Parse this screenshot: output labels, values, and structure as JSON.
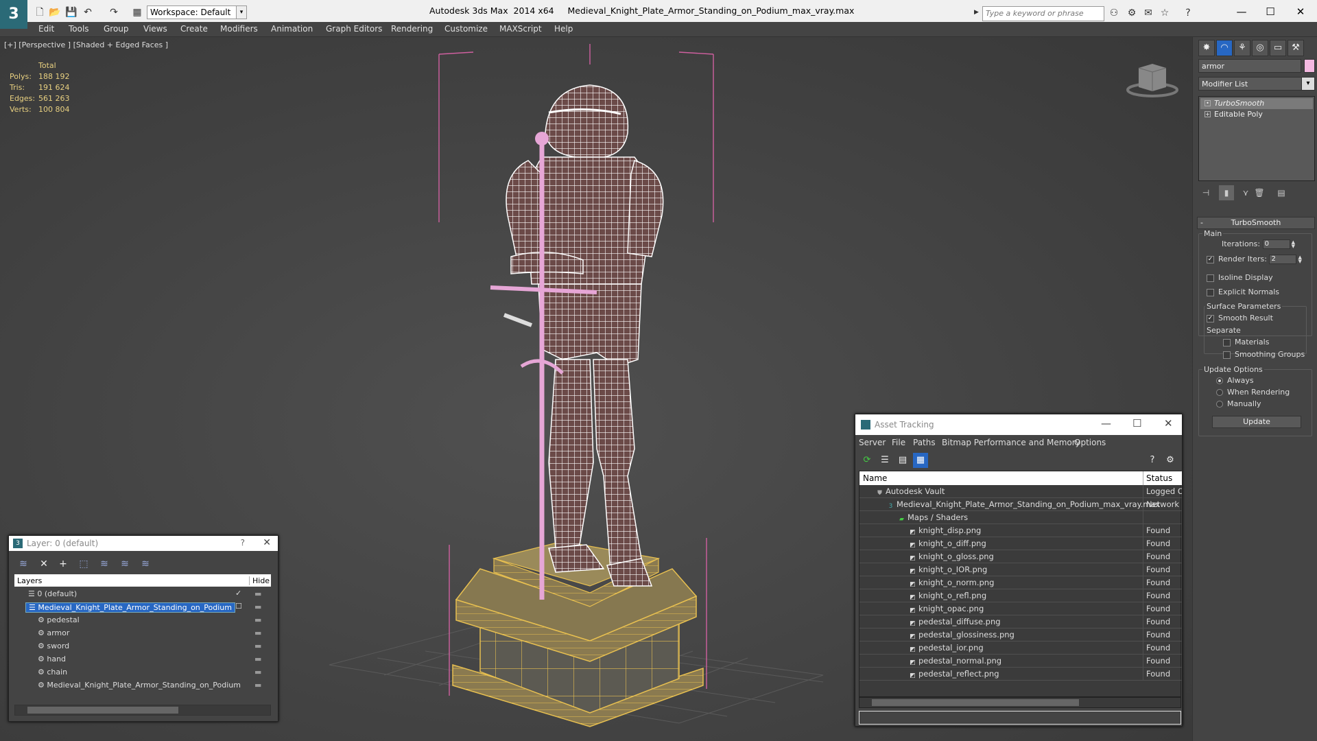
{
  "app": {
    "title": "Autodesk 3ds Max  2014 x64     Medieval_Knight_Plate_Armor_Standing_on_Podium_max_vray.max",
    "workspace": "Workspace: Default",
    "search_placeholder": "Type a keyword or phrase"
  },
  "menu": [
    "Edit",
    "Tools",
    "Group",
    "Views",
    "Create",
    "Modifiers",
    "Animation",
    "Graph Editors",
    "Rendering",
    "Customize",
    "MAXScript",
    "Help"
  ],
  "viewport": {
    "label": "[+] [Perspective ] [Shaded + Edged Faces ]",
    "stats_header": "Total",
    "stats": [
      {
        "k": "Polys:",
        "v": "188 192"
      },
      {
        "k": "Tris:",
        "v": "191 624"
      },
      {
        "k": "Edges:",
        "v": "561 263"
      },
      {
        "k": "Verts:",
        "v": "100 804"
      }
    ]
  },
  "command_panel": {
    "object_name": "armor",
    "modifier_list": "Modifier List",
    "stack": [
      "TurboSmooth",
      "Editable Poly"
    ],
    "rollout": {
      "title": "TurboSmooth",
      "main": "Main",
      "iterations_label": "Iterations:",
      "iterations": "0",
      "render_iters_label": "Render Iters:",
      "render_iters": "2",
      "isoline": "Isoline Display",
      "explicit": "Explicit Normals",
      "surface": "Surface Parameters",
      "smooth_result": "Smooth Result",
      "separate": "Separate",
      "materials": "Materials",
      "smoothing_groups": "Smoothing Groups",
      "update_options": "Update Options",
      "always": "Always",
      "when_rendering": "When Rendering",
      "manually": "Manually",
      "update": "Update"
    }
  },
  "layer_dialog": {
    "title": "Layer: 0 (default)",
    "help": "?",
    "col_layers": "Layers",
    "col_hide": "Hide",
    "rows": [
      {
        "name": "0 (default)",
        "indent": 1
      },
      {
        "name": "Medieval_Knight_Plate_Armor_Standing_on_Podium",
        "indent": 1
      },
      {
        "name": "pedestal",
        "indent": 2
      },
      {
        "name": "armor",
        "indent": 2
      },
      {
        "name": "sword",
        "indent": 2
      },
      {
        "name": "hand",
        "indent": 2
      },
      {
        "name": "chain",
        "indent": 2
      },
      {
        "name": "Medieval_Knight_Plate_Armor_Standing_on_Podium",
        "indent": 2
      }
    ]
  },
  "asset_tracking": {
    "title": "Asset Tracking",
    "menu": [
      "Server",
      "File",
      "Paths",
      "Bitmap Performance and Memory",
      "Options"
    ],
    "col_name": "Name",
    "col_status": "Status",
    "rows": [
      {
        "name": "Autodesk Vault",
        "status": "Logged Out",
        "level": 0
      },
      {
        "name": "Medieval_Knight_Plate_Armor_Standing_on_Podium_max_vray.max",
        "status": "Network",
        "level": 1
      },
      {
        "name": "Maps / Shaders",
        "status": "",
        "level": 2
      },
      {
        "name": "knight_disp.png",
        "status": "Found",
        "level": 3
      },
      {
        "name": "knight_o_diff.png",
        "status": "Found",
        "level": 3
      },
      {
        "name": "knight_o_gloss.png",
        "status": "Found",
        "level": 3
      },
      {
        "name": "knight_o_IOR.png",
        "status": "Found",
        "level": 3
      },
      {
        "name": "knight_o_norm.png",
        "status": "Found",
        "level": 3
      },
      {
        "name": "knight_o_refl.png",
        "status": "Found",
        "level": 3
      },
      {
        "name": "knight_opac.png",
        "status": "Found",
        "level": 3
      },
      {
        "name": "pedestal_diffuse.png",
        "status": "Found",
        "level": 3
      },
      {
        "name": "pedestal_glossiness.png",
        "status": "Found",
        "level": 3
      },
      {
        "name": "pedestal_ior.png",
        "status": "Found",
        "level": 3
      },
      {
        "name": "pedestal_normal.png",
        "status": "Found",
        "level": 3
      },
      {
        "name": "pedestal_reflect.png",
        "status": "Found",
        "level": 3
      }
    ]
  },
  "colors": {
    "selection": "#2767c3",
    "wire": "#ffffff",
    "pedestal_wire": "#e8c050",
    "sword": "#e6a6d6",
    "stats": "#e8d080"
  }
}
